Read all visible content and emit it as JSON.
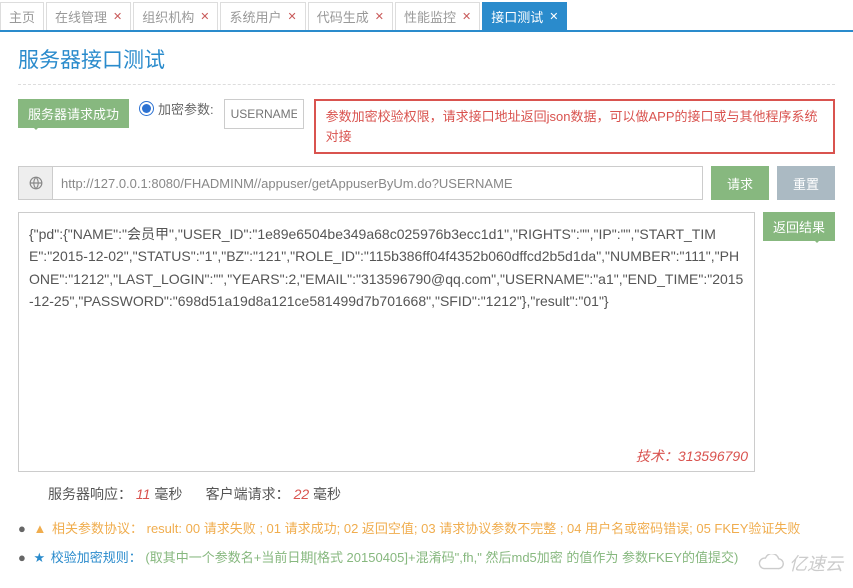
{
  "tabs": {
    "items": [
      {
        "label": "主页"
      },
      {
        "label": "在线管理"
      },
      {
        "label": "组织机构"
      },
      {
        "label": "系统用户"
      },
      {
        "label": "代码生成"
      },
      {
        "label": "性能监控"
      },
      {
        "label": "接口测试"
      }
    ],
    "activeIndex": 6
  },
  "page": {
    "title": "服务器接口测试"
  },
  "request_success_tag": "服务器请求成功",
  "encrypt_radio_label": "加密参数:",
  "param_placeholder": "USERNAME",
  "note_text": "参数加密校验权限，请求接口地址返回json数据，可以做APP的接口或与其他程序系统对接",
  "url_value": "http://127.0.0.1:8080/FHADMINM//appuser/getAppuserByUm.do?USERNAME",
  "btn_request": "请求",
  "btn_reset": "重置",
  "result_tag": "返回结果",
  "result_json": "{\"pd\":{\"NAME\":\"会员甲\",\"USER_ID\":\"1e89e6504be349a68c025976b3ecc1d1\",\"RIGHTS\":\"\",\"IP\":\"\",\"START_TIME\":\"2015-12-02\",\"STATUS\":\"1\",\"BZ\":\"121\",\"ROLE_ID\":\"115b386ff04f4352b060dffcd2b5d1da\",\"NUMBER\":\"111\",\"PHONE\":\"1212\",\"LAST_LOGIN\":\"\",\"YEARS\":2,\"EMAIL\":\"313596790@qq.com\",\"USERNAME\":\"a1\",\"END_TIME\":\"2015-12-25\",\"PASSWORD\":\"698d51a19d8a121ce581499d7b701668\",\"SFID\":\"1212\"},\"result\":\"01\"}",
  "tech_contact": "技术：313596790",
  "timing": {
    "server_label": "服务器响应：",
    "server_value": "11",
    "client_label": "客户端请求：",
    "client_value": "22",
    "unit": "毫秒"
  },
  "protocol": {
    "label": "相关参数协议：",
    "text": "result: 00 请求失败 ; 01 请求成功; 02 返回空值; 03 请求协议参数不完整 ; 04 用户名或密码错误; 05 FKEY验证失败"
  },
  "rule": {
    "label": "校验加密规则：",
    "text": "(取其中一个参数名+当前日期[格式 20150405]+混淆码\",fh,\" 然后md5加密 的值作为 参数FKEY的值提交)"
  },
  "watermark": "亿速云"
}
